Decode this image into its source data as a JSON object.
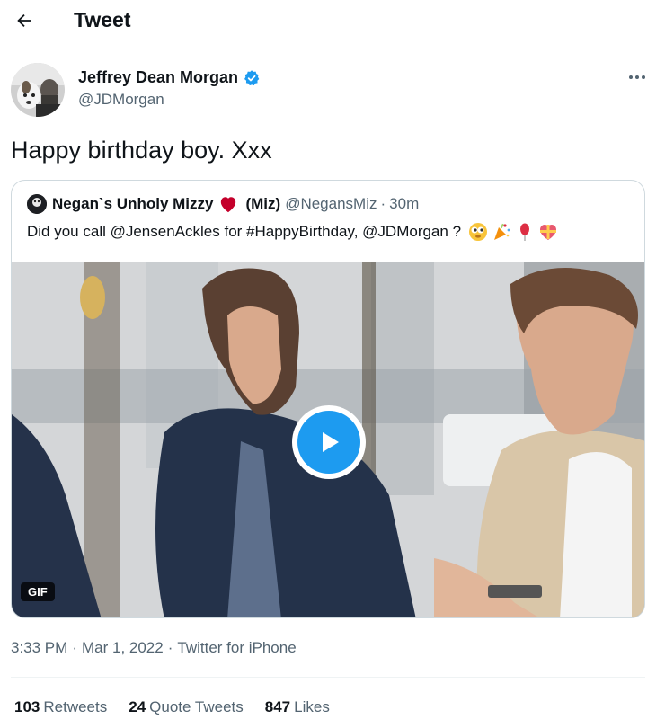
{
  "header": {
    "title": "Tweet"
  },
  "author": {
    "name": "Jeffrey Dean Morgan",
    "handle": "@JDMorgan",
    "verified": true
  },
  "tweet": {
    "text": "Happy birthday boy. Xxx"
  },
  "quote": {
    "name_prefix": "Negan`s Unholy Mizzy",
    "name_suffix": "(Miz)",
    "handle": "@NegansMiz",
    "separator": "·",
    "time": "30m",
    "text": "Did you call @JensenAckles for #HappyBirthday, @JDMorgan ?",
    "emojis": [
      "eyes-emoji",
      "party-popper-emoji",
      "balloon-emoji",
      "gift-heart-emoji"
    ],
    "media_badge": "GIF"
  },
  "meta": {
    "time": "3:33 PM",
    "sep1": "·",
    "date": "Mar 1, 2022",
    "sep2": "·",
    "source": "Twitter for iPhone"
  },
  "stats": {
    "retweets_count": "103",
    "retweets_label": "Retweets",
    "quotes_count": "24",
    "quotes_label": "Quote Tweets",
    "likes_count": "847",
    "likes_label": "Likes"
  },
  "colors": {
    "accent": "#1d9bf0",
    "text": "#0f1419",
    "secondary": "#536471",
    "heart": "#c4002b"
  }
}
